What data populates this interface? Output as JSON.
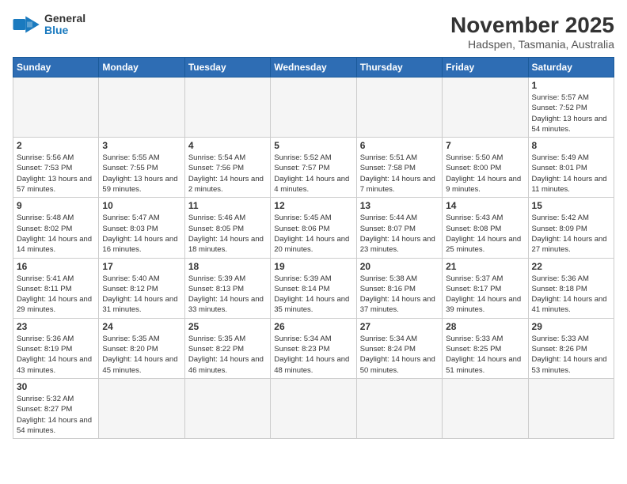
{
  "header": {
    "logo_general": "General",
    "logo_blue": "Blue",
    "month": "November 2025",
    "location": "Hadspen, Tasmania, Australia"
  },
  "weekdays": [
    "Sunday",
    "Monday",
    "Tuesday",
    "Wednesday",
    "Thursday",
    "Friday",
    "Saturday"
  ],
  "weeks": [
    [
      {
        "day": "",
        "info": ""
      },
      {
        "day": "",
        "info": ""
      },
      {
        "day": "",
        "info": ""
      },
      {
        "day": "",
        "info": ""
      },
      {
        "day": "",
        "info": ""
      },
      {
        "day": "",
        "info": ""
      },
      {
        "day": "1",
        "info": "Sunrise: 5:57 AM\nSunset: 7:52 PM\nDaylight: 13 hours and 54 minutes."
      }
    ],
    [
      {
        "day": "2",
        "info": "Sunrise: 5:56 AM\nSunset: 7:53 PM\nDaylight: 13 hours and 57 minutes."
      },
      {
        "day": "3",
        "info": "Sunrise: 5:55 AM\nSunset: 7:55 PM\nDaylight: 13 hours and 59 minutes."
      },
      {
        "day": "4",
        "info": "Sunrise: 5:54 AM\nSunset: 7:56 PM\nDaylight: 14 hours and 2 minutes."
      },
      {
        "day": "5",
        "info": "Sunrise: 5:52 AM\nSunset: 7:57 PM\nDaylight: 14 hours and 4 minutes."
      },
      {
        "day": "6",
        "info": "Sunrise: 5:51 AM\nSunset: 7:58 PM\nDaylight: 14 hours and 7 minutes."
      },
      {
        "day": "7",
        "info": "Sunrise: 5:50 AM\nSunset: 8:00 PM\nDaylight: 14 hours and 9 minutes."
      },
      {
        "day": "8",
        "info": "Sunrise: 5:49 AM\nSunset: 8:01 PM\nDaylight: 14 hours and 11 minutes."
      }
    ],
    [
      {
        "day": "9",
        "info": "Sunrise: 5:48 AM\nSunset: 8:02 PM\nDaylight: 14 hours and 14 minutes."
      },
      {
        "day": "10",
        "info": "Sunrise: 5:47 AM\nSunset: 8:03 PM\nDaylight: 14 hours and 16 minutes."
      },
      {
        "day": "11",
        "info": "Sunrise: 5:46 AM\nSunset: 8:05 PM\nDaylight: 14 hours and 18 minutes."
      },
      {
        "day": "12",
        "info": "Sunrise: 5:45 AM\nSunset: 8:06 PM\nDaylight: 14 hours and 20 minutes."
      },
      {
        "day": "13",
        "info": "Sunrise: 5:44 AM\nSunset: 8:07 PM\nDaylight: 14 hours and 23 minutes."
      },
      {
        "day": "14",
        "info": "Sunrise: 5:43 AM\nSunset: 8:08 PM\nDaylight: 14 hours and 25 minutes."
      },
      {
        "day": "15",
        "info": "Sunrise: 5:42 AM\nSunset: 8:09 PM\nDaylight: 14 hours and 27 minutes."
      }
    ],
    [
      {
        "day": "16",
        "info": "Sunrise: 5:41 AM\nSunset: 8:11 PM\nDaylight: 14 hours and 29 minutes."
      },
      {
        "day": "17",
        "info": "Sunrise: 5:40 AM\nSunset: 8:12 PM\nDaylight: 14 hours and 31 minutes."
      },
      {
        "day": "18",
        "info": "Sunrise: 5:39 AM\nSunset: 8:13 PM\nDaylight: 14 hours and 33 minutes."
      },
      {
        "day": "19",
        "info": "Sunrise: 5:39 AM\nSunset: 8:14 PM\nDaylight: 14 hours and 35 minutes."
      },
      {
        "day": "20",
        "info": "Sunrise: 5:38 AM\nSunset: 8:16 PM\nDaylight: 14 hours and 37 minutes."
      },
      {
        "day": "21",
        "info": "Sunrise: 5:37 AM\nSunset: 8:17 PM\nDaylight: 14 hours and 39 minutes."
      },
      {
        "day": "22",
        "info": "Sunrise: 5:36 AM\nSunset: 8:18 PM\nDaylight: 14 hours and 41 minutes."
      }
    ],
    [
      {
        "day": "23",
        "info": "Sunrise: 5:36 AM\nSunset: 8:19 PM\nDaylight: 14 hours and 43 minutes."
      },
      {
        "day": "24",
        "info": "Sunrise: 5:35 AM\nSunset: 8:20 PM\nDaylight: 14 hours and 45 minutes."
      },
      {
        "day": "25",
        "info": "Sunrise: 5:35 AM\nSunset: 8:22 PM\nDaylight: 14 hours and 46 minutes."
      },
      {
        "day": "26",
        "info": "Sunrise: 5:34 AM\nSunset: 8:23 PM\nDaylight: 14 hours and 48 minutes."
      },
      {
        "day": "27",
        "info": "Sunrise: 5:34 AM\nSunset: 8:24 PM\nDaylight: 14 hours and 50 minutes."
      },
      {
        "day": "28",
        "info": "Sunrise: 5:33 AM\nSunset: 8:25 PM\nDaylight: 14 hours and 51 minutes."
      },
      {
        "day": "29",
        "info": "Sunrise: 5:33 AM\nSunset: 8:26 PM\nDaylight: 14 hours and 53 minutes."
      }
    ],
    [
      {
        "day": "30",
        "info": "Sunrise: 5:32 AM\nSunset: 8:27 PM\nDaylight: 14 hours and 54 minutes."
      },
      {
        "day": "",
        "info": ""
      },
      {
        "day": "",
        "info": ""
      },
      {
        "day": "",
        "info": ""
      },
      {
        "day": "",
        "info": ""
      },
      {
        "day": "",
        "info": ""
      },
      {
        "day": "",
        "info": ""
      }
    ]
  ]
}
